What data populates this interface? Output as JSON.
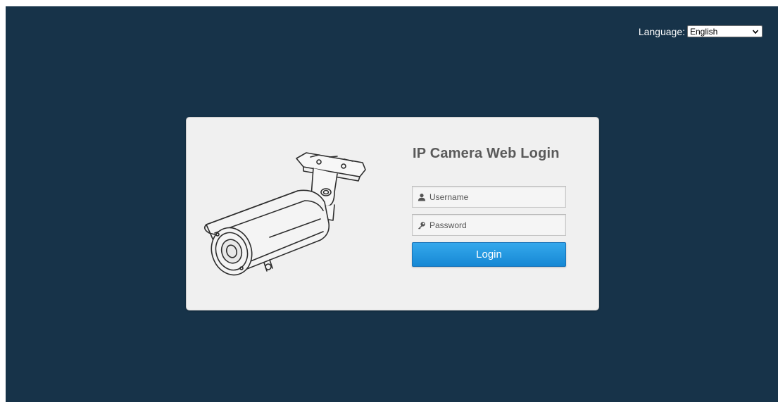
{
  "language": {
    "label": "Language:",
    "selected": "English",
    "icon": "chevron-down-icon"
  },
  "login": {
    "title": "IP Camera Web Login",
    "username_placeholder": "Username",
    "password_placeholder": "Password",
    "button_label": "Login",
    "username_icon": "user-icon",
    "password_icon": "key-icon"
  },
  "colors": {
    "background": "#173349",
    "panel": "#f0f0f0",
    "button": "#1a8ad6",
    "title": "#5a5a5a"
  }
}
